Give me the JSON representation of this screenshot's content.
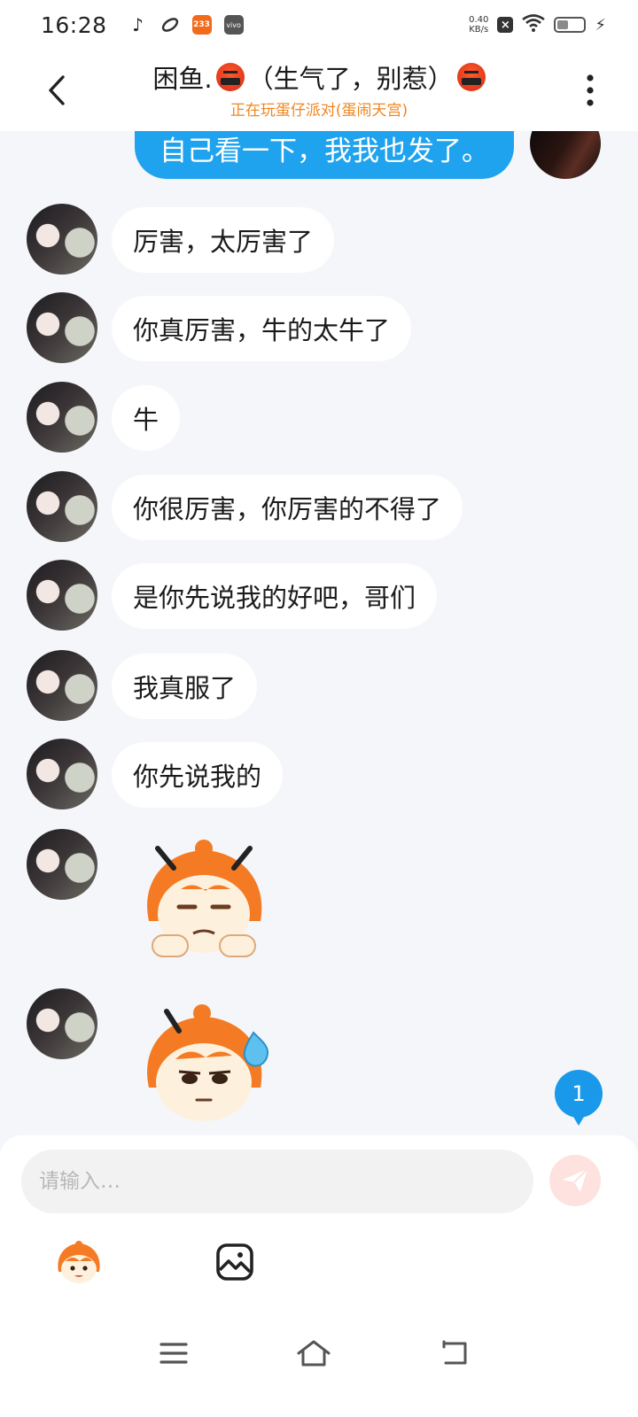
{
  "status_bar": {
    "time": "16:28",
    "app_icons": [
      "tiktok-icon",
      "swirl-app-icon",
      "233-app-icon",
      "vivo-icon"
    ],
    "app_233_label": "233",
    "app_vivo_label": "vivo",
    "net_speed_value": "0.40",
    "net_speed_unit": "KB/s",
    "battery_level": 0.35
  },
  "header": {
    "title": "困鱼.🤬（生气了，别惹）🤬",
    "title_name": "困鱼.",
    "title_status": "（生气了，别惹）",
    "subtitle": "正在玩蛋仔派对(蛋闹天宫)"
  },
  "messages": {
    "own_last": "自己看一下，我我也发了。",
    "received": [
      "厉害，太厉害了",
      "你真厉害，牛的太牛了",
      "牛",
      "你很厉害，你厉害的不得了",
      "是你先说我的好吧，哥们",
      "我真服了",
      "你先说我的"
    ],
    "stickers": [
      "eggy-unimpressed-sticker",
      "eggy-sweat-sticker"
    ]
  },
  "unread_count": "1",
  "composer": {
    "placeholder": "请输入…"
  },
  "colors": {
    "accent_blue": "#20a3ee",
    "subtitle_orange": "#f0851e",
    "send_disabled": "#fde2df",
    "background": "#f4f6f9"
  }
}
